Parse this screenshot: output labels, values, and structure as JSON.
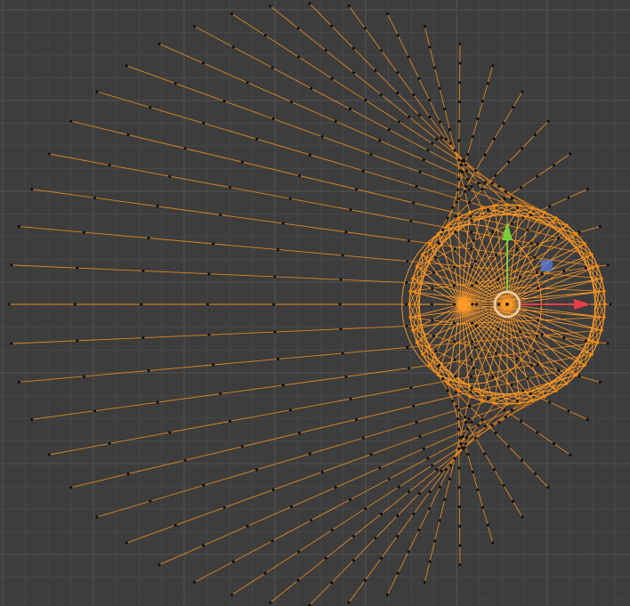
{
  "viewport": {
    "background_color": "#3d3d3d",
    "grid_minor_color": "#474747",
    "grid_major_color": "#525252"
  },
  "mesh": {
    "edge_color": "#f08c1e",
    "inner_edge_color": "#ff9b28",
    "vertex_color": "#111111",
    "selected_vertex_color": "#ff8a00",
    "rings": 9,
    "spokes": 48
  },
  "gizmo": {
    "x_axis_color": "#e8404a",
    "y_axis_color": "#7bcf3a",
    "plane_handle_color": "#5a7ce0",
    "center_ring_color": "#f5d2a8",
    "x_axis_icon": "arrow-right-icon",
    "y_axis_icon": "arrow-up-icon",
    "xy_plane_icon": "square-handle-icon",
    "pivot_icon": "circle-pivot-icon"
  }
}
